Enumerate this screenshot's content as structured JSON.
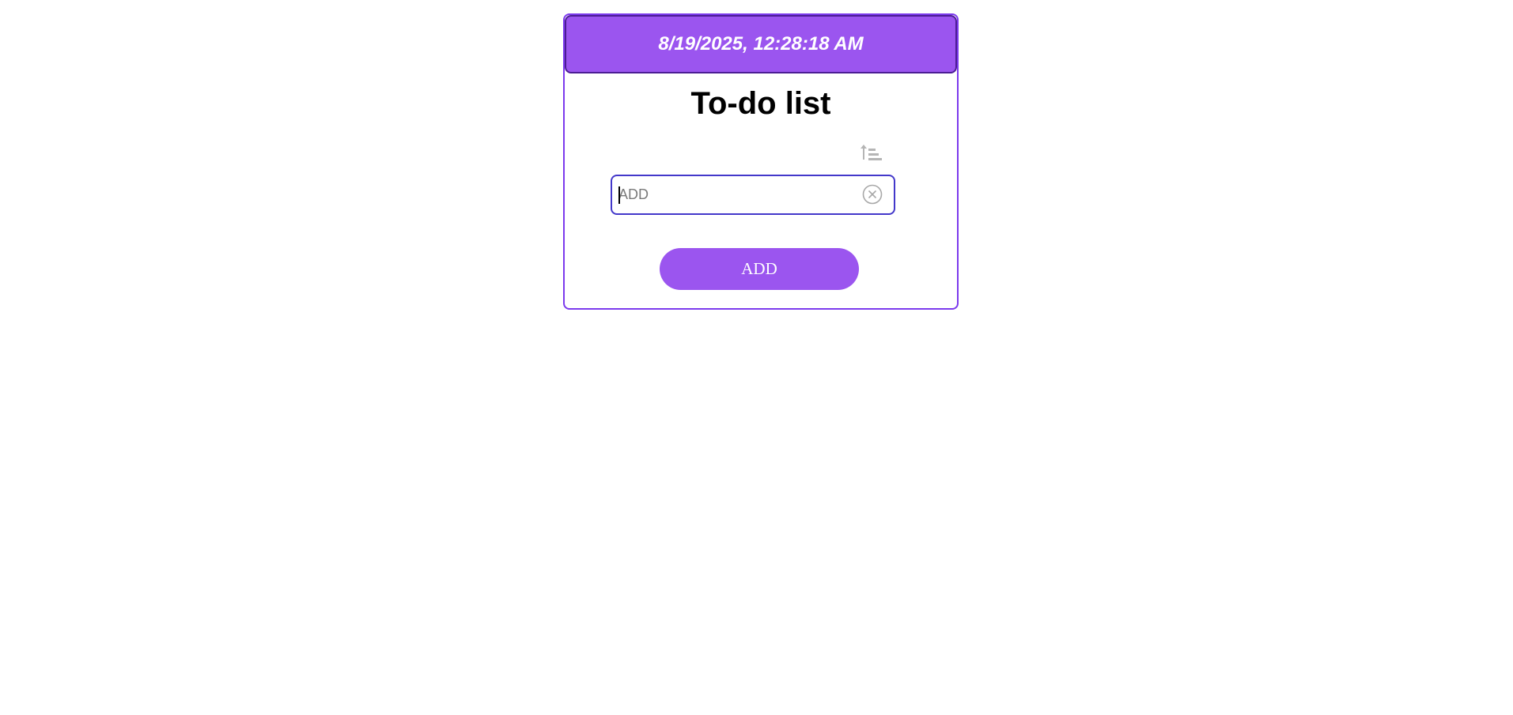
{
  "header": {
    "datetime": "8/19/2025, 12:28:18 AM"
  },
  "title": "To-do list",
  "sort": {
    "icon": "sort-ascending-icon"
  },
  "input": {
    "value": "",
    "placeholder": "ADD",
    "clear_icon": "close-circle-icon"
  },
  "add_button": {
    "label": "ADD"
  },
  "colors": {
    "accent": "#9b55ef",
    "border": "#7c3aed",
    "input_border": "#4338ca"
  }
}
